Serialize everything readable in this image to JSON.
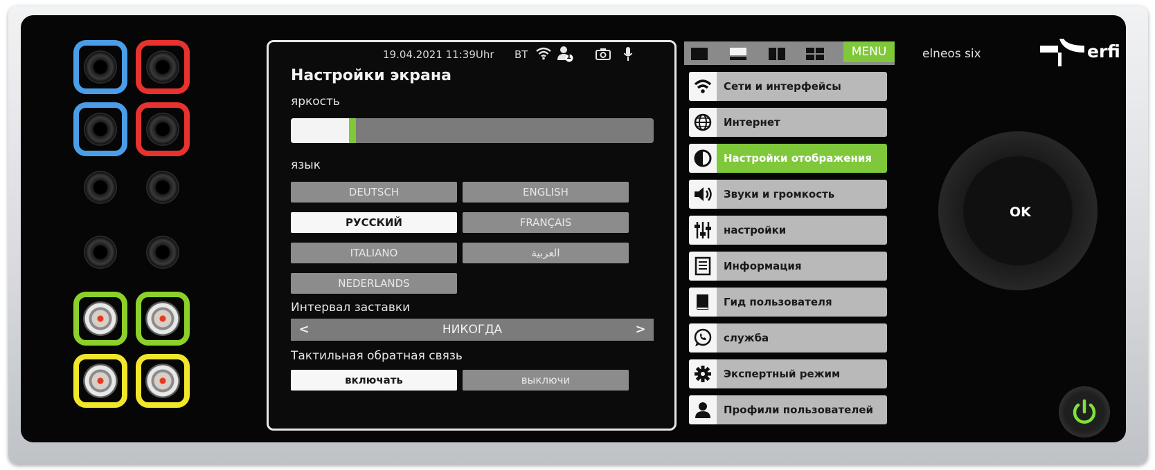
{
  "status_bar": {
    "datetime": "19.04.2021 11:39Uhr",
    "bt": "BT",
    "user_badge": "1",
    "icons": [
      "wifi-icon",
      "user-icon",
      "camera-icon",
      "microphone-icon"
    ]
  },
  "screen": {
    "title": "Настройки экрана",
    "brightness_label": "яркость",
    "brightness_level": 0.17,
    "language_label": "язык",
    "languages": [
      {
        "label": "DEUTSCH",
        "selected": false
      },
      {
        "label": "ENGLISH",
        "selected": false
      },
      {
        "label": "РУССКИЙ",
        "selected": true
      },
      {
        "label": "FRANÇAIS",
        "selected": false
      },
      {
        "label": "ITALIANO",
        "selected": false
      },
      {
        "label": "العربية",
        "selected": false
      },
      {
        "label": "NEDERLANDS",
        "selected": false
      }
    ],
    "screensaver_label": "Интервал заставки",
    "screensaver_value": "НИКОГДА",
    "haptic_label": "Тактильная обратная связь",
    "haptic_on": "включать",
    "haptic_off": "выключи",
    "haptic_selected": "on"
  },
  "menu": {
    "label": "MENU",
    "view_modes": [
      "view-full-icon",
      "view-split-horizontal-icon",
      "view-split-vertical-icon",
      "view-quad-icon"
    ],
    "items": [
      {
        "label": "Сети и интерфейсы",
        "icon": "wifi-icon",
        "active": false
      },
      {
        "label": "Интернет",
        "icon": "globe-icon",
        "active": false
      },
      {
        "label": "Настройки отображения",
        "icon": "contrast-icon",
        "active": true
      },
      {
        "label": "Звуки и громкость",
        "icon": "speaker-icon",
        "active": false
      },
      {
        "label": "настройки",
        "icon": "sliders-icon",
        "active": false
      },
      {
        "label": "Информация",
        "icon": "document-icon",
        "active": false
      },
      {
        "label": "Гид пользователя",
        "icon": "book-icon",
        "active": false
      },
      {
        "label": "служба",
        "icon": "whatsapp-icon",
        "active": false
      },
      {
        "label": "Экспертный режим",
        "icon": "gear-icon",
        "active": false
      },
      {
        "label": "Профили пользователей",
        "icon": "user-profile-icon",
        "active": false
      }
    ]
  },
  "device": {
    "model": "elneos six",
    "brand": "erfi",
    "knob_label": "OK"
  },
  "colors": {
    "accent_green": "#7ec83a",
    "jack_blue": "#4a9ee8",
    "jack_red": "#e8322e",
    "jack_green": "#8bd12a",
    "jack_yellow": "#f1e62a"
  }
}
